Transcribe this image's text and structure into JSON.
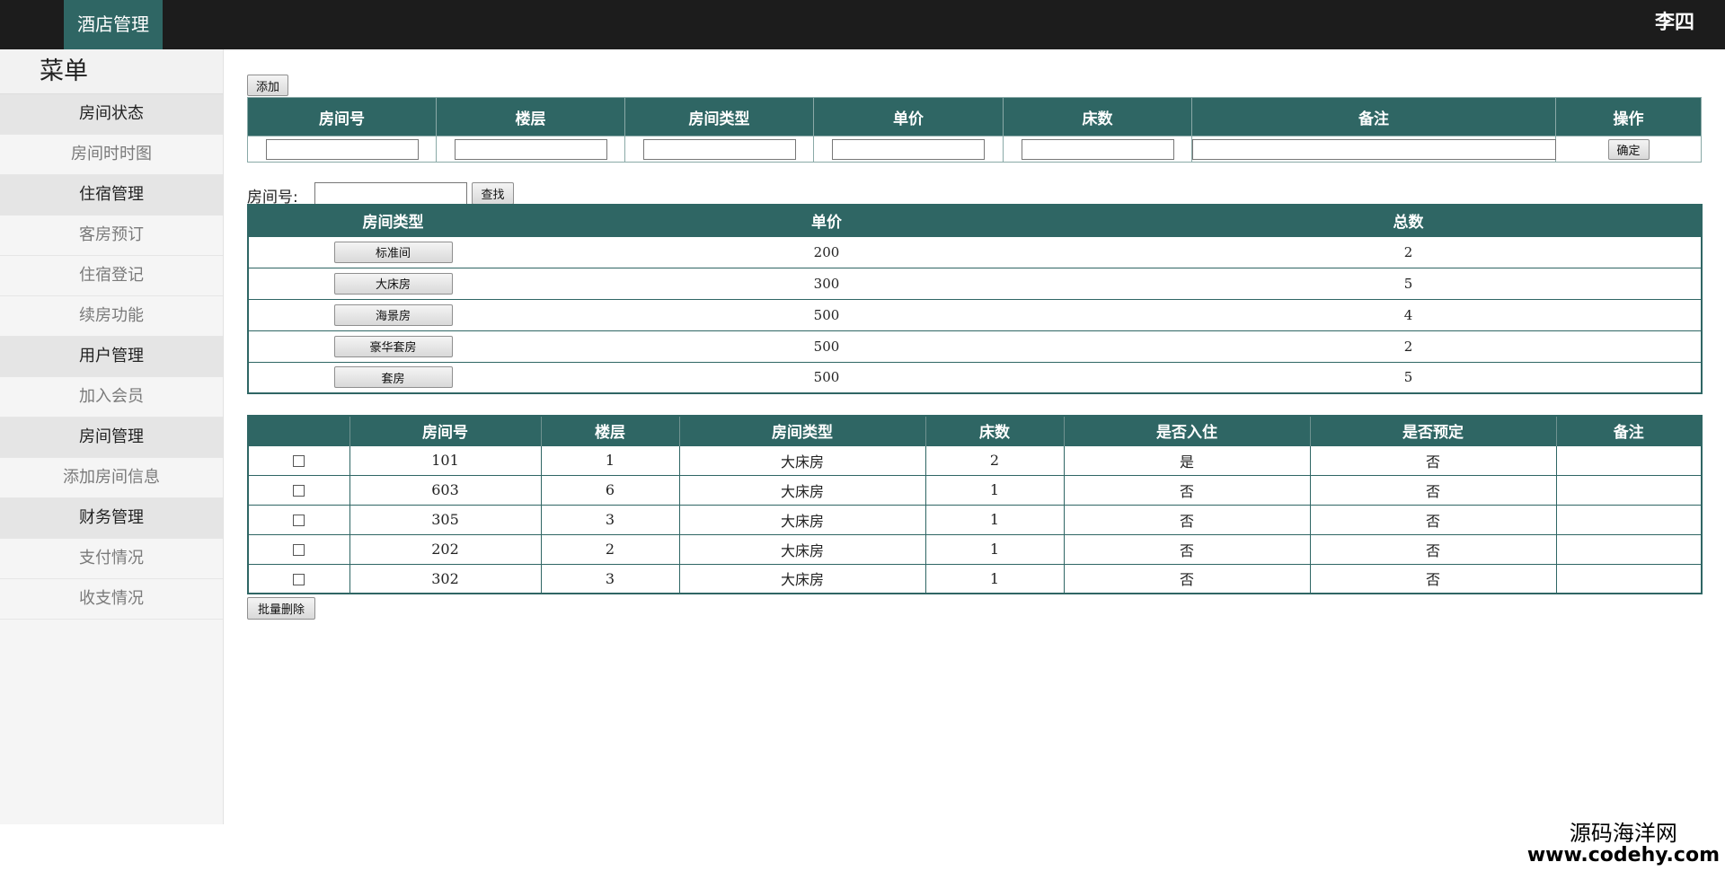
{
  "header": {
    "brand": "酒店管理",
    "user": "李四"
  },
  "sidebar": {
    "title": "菜单",
    "items": [
      {
        "label": "房间状态",
        "type": "group"
      },
      {
        "label": "房间时时图",
        "type": "sub"
      },
      {
        "label": "住宿管理",
        "type": "group"
      },
      {
        "label": "客房预订",
        "type": "sub"
      },
      {
        "label": "住宿登记",
        "type": "sub"
      },
      {
        "label": "续房功能",
        "type": "sub"
      },
      {
        "label": "用户管理",
        "type": "group"
      },
      {
        "label": "加入会员",
        "type": "sub"
      },
      {
        "label": "房间管理",
        "type": "group"
      },
      {
        "label": "添加房间信息",
        "type": "sub"
      },
      {
        "label": "财务管理",
        "type": "group"
      },
      {
        "label": "支付情况",
        "type": "sub"
      },
      {
        "label": "收支情况",
        "type": "sub"
      }
    ]
  },
  "add_form": {
    "add_label": "添加",
    "headers": [
      "房间号",
      "楼层",
      "房间类型",
      "单价",
      "床数",
      "备注",
      "操作"
    ],
    "confirm_label": "确定"
  },
  "search": {
    "label": "房间号:",
    "button_label": "查找"
  },
  "types_table": {
    "headers": [
      "房间类型",
      "单价",
      "总数"
    ],
    "rows": [
      {
        "type": "标准间",
        "price": "200",
        "total": "2"
      },
      {
        "type": "大床房",
        "price": "300",
        "total": "5"
      },
      {
        "type": "海景房",
        "price": "500",
        "total": "4"
      },
      {
        "type": "豪华套房",
        "price": "500",
        "total": "2"
      },
      {
        "type": "套房",
        "price": "500",
        "total": "5"
      }
    ]
  },
  "rooms_table": {
    "headers": [
      "",
      "房间号",
      "楼层",
      "房间类型",
      "床数",
      "是否入住",
      "是否预定",
      "备注"
    ],
    "rows": [
      {
        "room": "101",
        "floor": "1",
        "type": "大床房",
        "beds": "2",
        "occupied": "是",
        "reserved": "否",
        "note": ""
      },
      {
        "room": "603",
        "floor": "6",
        "type": "大床房",
        "beds": "1",
        "occupied": "否",
        "reserved": "否",
        "note": ""
      },
      {
        "room": "305",
        "floor": "3",
        "type": "大床房",
        "beds": "1",
        "occupied": "否",
        "reserved": "否",
        "note": ""
      },
      {
        "room": "202",
        "floor": "2",
        "type": "大床房",
        "beds": "1",
        "occupied": "否",
        "reserved": "否",
        "note": ""
      },
      {
        "room": "302",
        "floor": "3",
        "type": "大床房",
        "beds": "1",
        "occupied": "否",
        "reserved": "否",
        "note": ""
      }
    ]
  },
  "batch_delete_label": "批量删除",
  "watermark": {
    "line1": "源码海洋网",
    "line2": "www.codehy.com"
  }
}
